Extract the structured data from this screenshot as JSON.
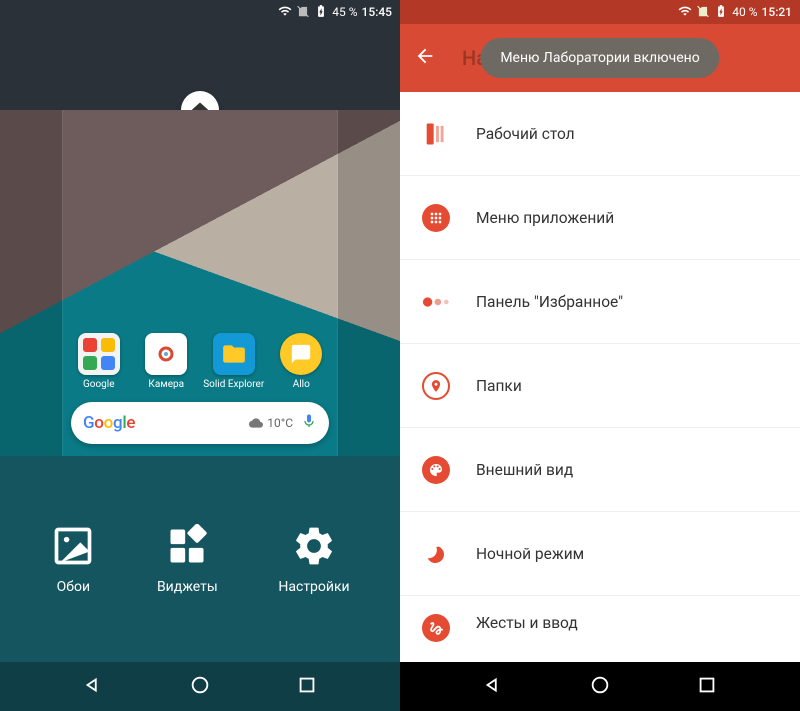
{
  "left": {
    "status": {
      "battery": "45 %",
      "time": "15:45"
    },
    "apps": [
      {
        "label": "Google"
      },
      {
        "label": "Камера"
      },
      {
        "label": "Solid Explorer"
      },
      {
        "label": "Allo"
      }
    ],
    "search": {
      "weather": "10°C"
    },
    "options": [
      {
        "label": "Обои"
      },
      {
        "label": "Виджеты"
      },
      {
        "label": "Настройки"
      }
    ]
  },
  "right": {
    "status": {
      "battery": "40 %",
      "time": "15:21"
    },
    "appbar": {
      "faded_title": "Настройки Nova",
      "toast": "Меню Лаборатории включено"
    },
    "items": [
      {
        "label": "Рабочий стол"
      },
      {
        "label": "Меню приложений"
      },
      {
        "label": "Панель \"Избранное\""
      },
      {
        "label": "Папки"
      },
      {
        "label": "Внешний вид"
      },
      {
        "label": "Ночной режим"
      },
      {
        "label": "Жесты и ввод"
      }
    ]
  }
}
